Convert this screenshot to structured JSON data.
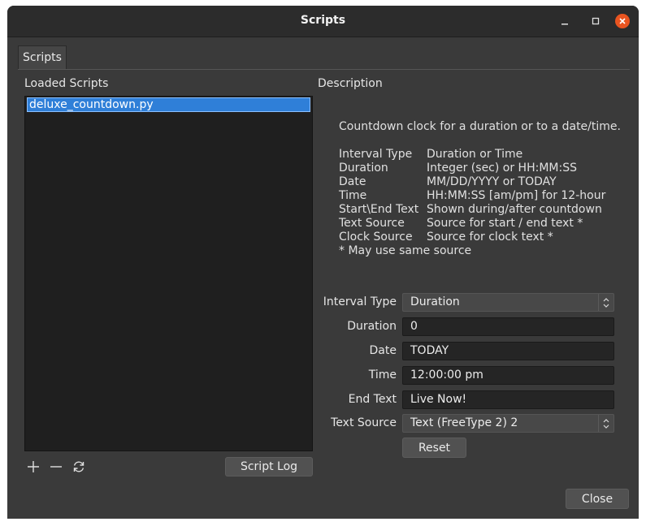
{
  "window": {
    "title": "Scripts"
  },
  "tabs": [
    {
      "label": "Scripts"
    }
  ],
  "left_panel": {
    "heading": "Loaded Scripts",
    "scripts": [
      "deluxe_countdown.py"
    ],
    "selected_index": 0,
    "toolbar_icons": [
      "add-icon",
      "remove-icon",
      "reload-icon"
    ],
    "script_log_label": "Script Log"
  },
  "right_panel": {
    "heading": "Description",
    "summary": "Countdown clock for a duration or to a date/time.",
    "table": [
      {
        "key": "Interval Type",
        "value": "Duration or Time"
      },
      {
        "key": "Duration",
        "value": "Integer (sec) or HH:MM:SS"
      },
      {
        "key": "Date",
        "value": "MM/DD/YYYY or TODAY"
      },
      {
        "key": "Time",
        "value": "HH:MM:SS [am/pm] for 12-hour"
      },
      {
        "key": "Start\\End Text",
        "value": "Shown during/after countdown"
      },
      {
        "key": "Text Source",
        "value": "Source for start / end text *"
      },
      {
        "key": "Clock Source",
        "value": "Source for clock text *"
      }
    ],
    "footnote": "* May use same source"
  },
  "properties": {
    "interval_type": {
      "label": "Interval Type",
      "value": "Duration"
    },
    "duration": {
      "label": "Duration",
      "value": "0"
    },
    "date": {
      "label": "Date",
      "value": "TODAY"
    },
    "time": {
      "label": "Time",
      "value": "12:00:00 pm"
    },
    "end_text": {
      "label": "End Text",
      "value": "Live Now!"
    },
    "text_source": {
      "label": "Text Source",
      "value": "Text (FreeType 2) 2"
    },
    "reset_label": "Reset"
  },
  "footer": {
    "close_label": "Close"
  },
  "colors": {
    "accent": "#e95420",
    "selection": "#2f7fd8"
  }
}
